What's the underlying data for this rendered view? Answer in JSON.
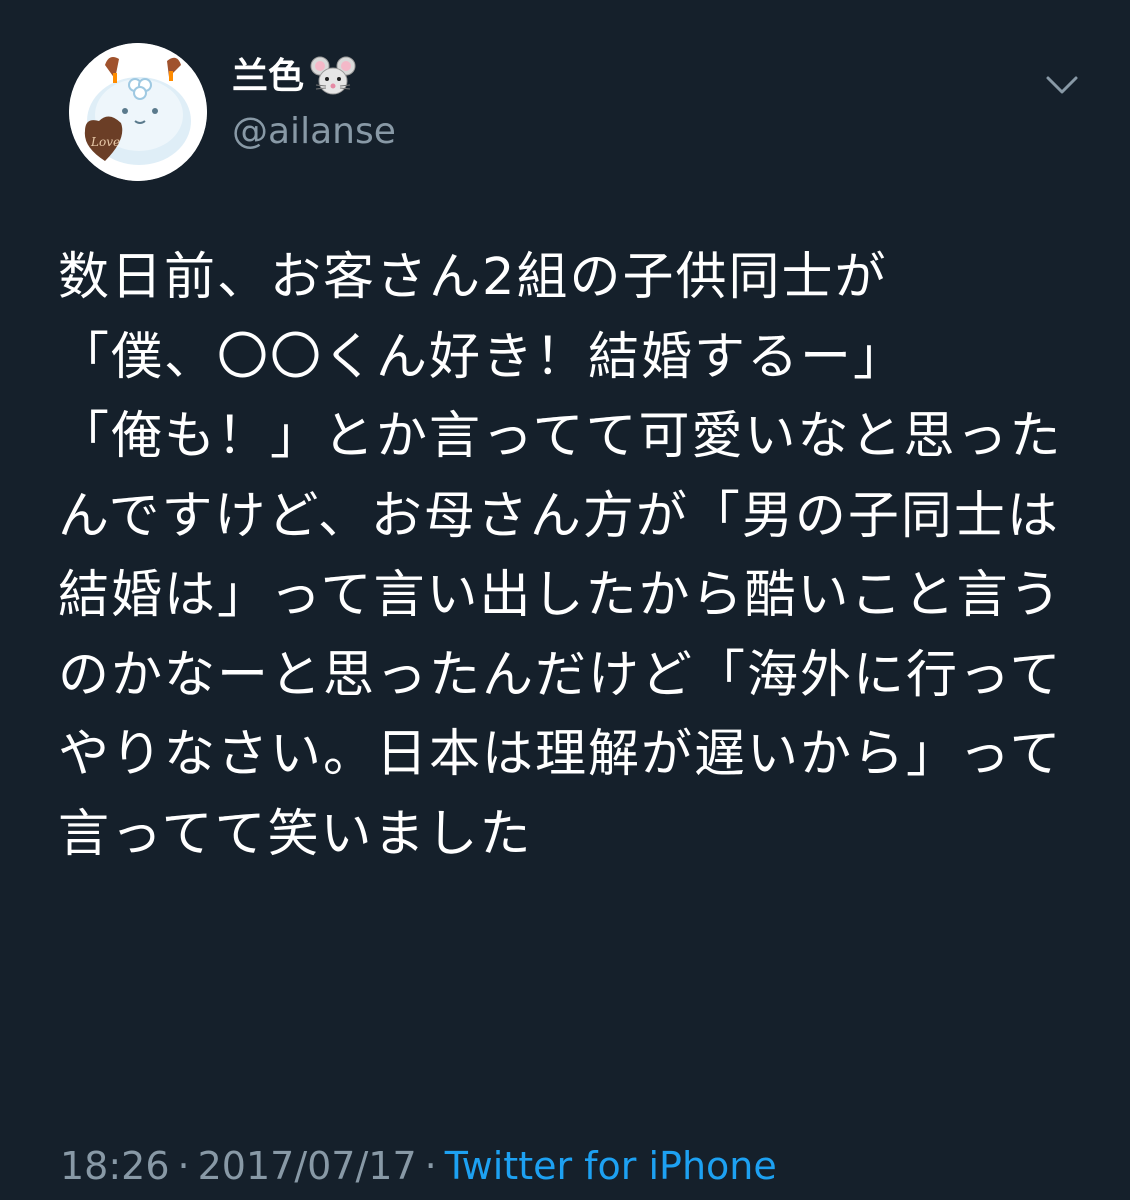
{
  "user": {
    "display_name": "兰色",
    "name_emoji_icon": "mouse-face-icon",
    "handle": "@ailanse",
    "avatar_icon": "avatar-image",
    "avatar_text": "Love"
  },
  "menu": {
    "caret_icon": "chevron-down-icon"
  },
  "tweet": {
    "text": "数日前、お客さん2組の子供同士が\n「僕、〇〇くん好き！結婚するー」\n「俺も！」とか言ってて可愛いなと思ったんですけど、お母さん方が「男の子同士は結婚は」って言い出したから酷いこと言うのかなーと思ったんだけど「海外に行ってやりなさい。日本は理解が遅いから」って言ってて笑いました",
    "time": "18:26",
    "date": "2017/07/17",
    "source": "Twitter for iPhone"
  },
  "colors": {
    "background": "#15202b",
    "text": "#ffffff",
    "secondary": "#8899a6",
    "link": "#1da1f2"
  }
}
